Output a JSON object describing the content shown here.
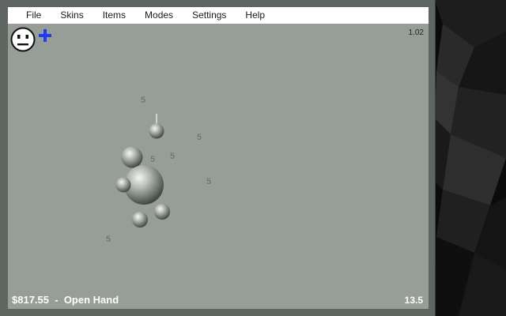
{
  "menu": {
    "items": [
      "File",
      "Skins",
      "Items",
      "Modes",
      "Settings",
      "Help"
    ]
  },
  "game": {
    "version": "1.02",
    "money_label": "$817.55",
    "separator": "-",
    "hand_label": "Open Hand",
    "timer": "13.5",
    "floating_values": [
      "5",
      "5",
      "5",
      "5",
      "5",
      "5"
    ]
  },
  "colors": {
    "field": "#979e98",
    "frame": "#5f6661",
    "plus": "#1f3cf0",
    "text": "#ffffff"
  },
  "icons": {
    "face": "neutral-face-icon",
    "add": "plus-icon"
  }
}
